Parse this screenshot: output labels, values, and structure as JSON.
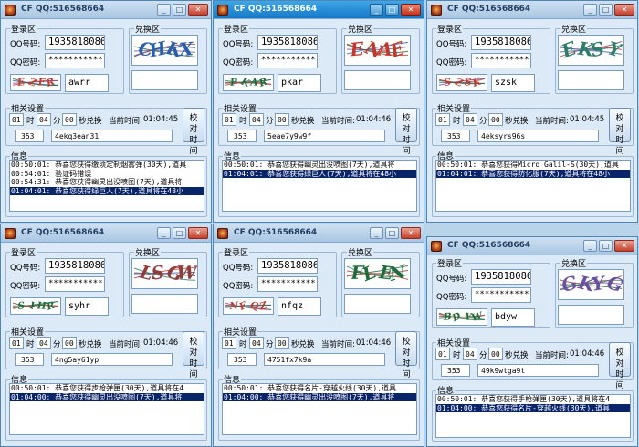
{
  "labels": {
    "login_group": "登录区",
    "qq_no": "QQ号码:",
    "qq_pwd": "QQ密码:",
    "redeem_group": "兑换区",
    "settings_group": "相关设置",
    "time_label": "时",
    "min_label": "分",
    "sec_label": "秒兑换",
    "current_time_label": "当前时间:",
    "calibrate_button": "校对时间",
    "info_group": "信息"
  },
  "windows": [
    {
      "title": "CF  QQ:516568664",
      "active": false,
      "qq": "1935818086",
      "pwd": "***********",
      "captcha": "awrr",
      "captcha_image": "EZFR",
      "redeem_image": "CHKX",
      "hour": "01",
      "min": "04",
      "sec": "00",
      "current_time": "01:04:45",
      "count": "353",
      "code": "4ekq3ean31",
      "log": [
        {
          "text": "00:50:01: 恭喜您获得缴须定制烟雾弹(30天),道具",
          "sel": false
        },
        {
          "text": "00:54:01: 验证码错误",
          "sel": false
        },
        {
          "text": "00:54:31: 恭喜您获得幽灵出没喷图(7天),道具将",
          "sel": false
        },
        {
          "text": "01:04:01: 恭喜您获得绿巨人(7天),道具将在48小",
          "sel": true
        }
      ]
    },
    {
      "title": "CF  QQ:516568664",
      "active": true,
      "qq": "1935818086",
      "pwd": "***********",
      "captcha": "pkar",
      "captcha_image": "PKAR",
      "redeem_image": "ENAE",
      "hour": "01",
      "min": "04",
      "sec": "00",
      "current_time": "01:04:46",
      "count": "353",
      "code": "5eae7y9w9f",
      "log": [
        {
          "text": "00:50:01: 恭喜您获得幽灵出没喷图(7天),道具将",
          "sel": false
        },
        {
          "text": "01:04:01: 恭喜您获得绿巨人(7天),道具将在48小",
          "sel": true
        }
      ]
    },
    {
      "title": "CF  QQ:516568664",
      "active": false,
      "qq": "1935818086",
      "pwd": "***********",
      "captcha": "szsk",
      "captcha_image": "SZSK",
      "redeem_image": "EKSY",
      "hour": "01",
      "min": "04",
      "sec": "00",
      "current_time": "01:04:45",
      "count": "353",
      "code": "4eksyrs96s",
      "log": [
        {
          "text": "00:50:01: 恭喜您获得Micro Galil-S(30天),道具",
          "sel": false
        },
        {
          "text": "01:04:01: 恭喜您获得防化服(7天),道具将在48小",
          "sel": true
        }
      ]
    },
    {
      "title": "CF  QQ:516568664",
      "active": false,
      "qq": "1935818086",
      "pwd": "***********",
      "captcha": "syhr",
      "captcha_image": "SYHR",
      "redeem_image": "LSGW",
      "hour": "01",
      "min": "04",
      "sec": "00",
      "current_time": "01:04:46",
      "count": "353",
      "code": "4ng5ay61yp",
      "log": [
        {
          "text": "00:50:01: 恭喜您获得步枪弹匣(30天),道具将在4",
          "sel": false
        },
        {
          "text": "01:04:00: 恭喜您获得幽灵出没喷图(7天),道具将",
          "sel": true
        }
      ]
    },
    {
      "title": "CF  QQ:516568664",
      "active": false,
      "qq": "1935818086",
      "pwd": "***********",
      "captcha": "nfqz",
      "captcha_image": "NFQZ",
      "redeem_image": "FLEN",
      "hour": "01",
      "min": "04",
      "sec": "00",
      "current_time": "01:04:46",
      "count": "353",
      "code": "4751fx7k9a",
      "log": [
        {
          "text": "00:50:01: 恭喜您获得名片-穿越火线(30天),道具",
          "sel": false
        },
        {
          "text": "01:04:00: 恭喜您获得幽灵出没喷图(7天),道具将",
          "sel": true
        }
      ]
    },
    {
      "title": "CF  QQ:516568664",
      "active": false,
      "qq": "1935818086",
      "pwd": "***********",
      "captcha": "bdyw",
      "captcha_image": "BDYW",
      "redeem_image": "GKYG",
      "hour": "01",
      "min": "04",
      "sec": "00",
      "current_time": "01:04:46",
      "count": "353",
      "code": "49k9wtga9t",
      "log": [
        {
          "text": "00:50:01: 恭喜您获得手枪弹匣(30天),道具将在4",
          "sel": false
        },
        {
          "text": "01:04:00: 恭喜您获得名片-穿越火线(30天),道具",
          "sel": true
        }
      ]
    }
  ],
  "colors": {
    "active_title": "#1578c6",
    "selection": "#0a246a",
    "captcha_ink": [
      "#2e7d6a",
      "#c0392b",
      "#2a5ea8",
      "#6b4fa0"
    ]
  }
}
